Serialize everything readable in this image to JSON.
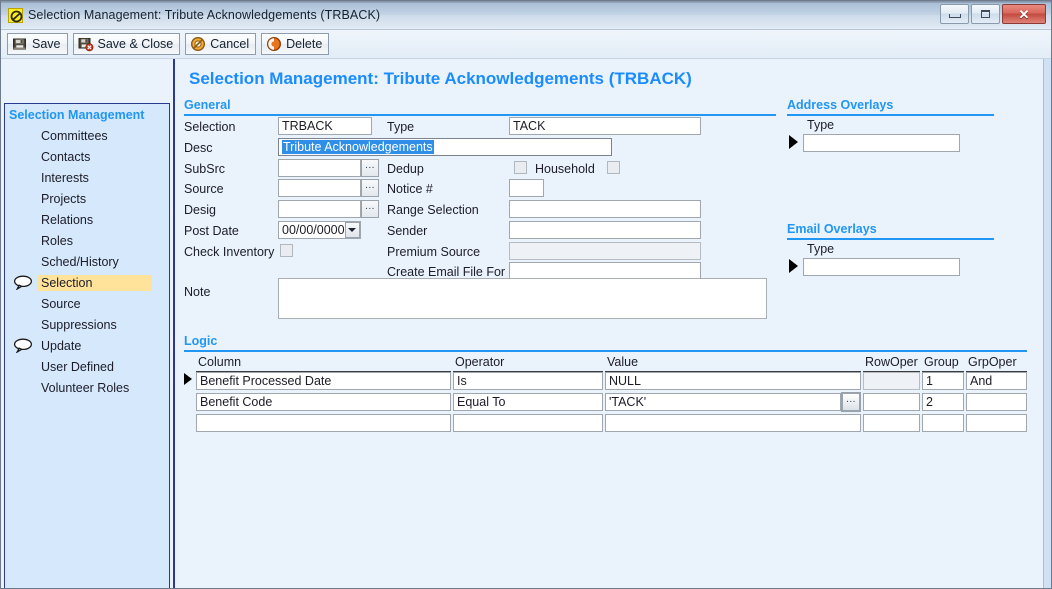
{
  "window": {
    "title": "Selection Management: Tribute Acknowledgements (TRBACK)",
    "app_icon": "prohibited-circle-icon",
    "minimize_label": "–",
    "maximize_label": "□",
    "close_label": "✕"
  },
  "toolbar": {
    "buttons": [
      {
        "label": "Save",
        "icon": "save-disk-icon"
      },
      {
        "label": "Save & Close",
        "icon": "save-close-icon"
      },
      {
        "label": "Cancel",
        "icon": "cancel-circle-icon"
      },
      {
        "label": "Delete",
        "icon": "delete-circle-icon"
      }
    ]
  },
  "sidebar": {
    "header": "Selection Management",
    "items": [
      {
        "label": "Committees",
        "bubble": false,
        "selected": false
      },
      {
        "label": "Contacts",
        "bubble": false,
        "selected": false
      },
      {
        "label": "Interests",
        "bubble": false,
        "selected": false
      },
      {
        "label": "Projects",
        "bubble": false,
        "selected": false
      },
      {
        "label": "Relations",
        "bubble": false,
        "selected": false
      },
      {
        "label": "Roles",
        "bubble": false,
        "selected": false
      },
      {
        "label": "Sched/History",
        "bubble": false,
        "selected": false
      },
      {
        "label": "Selection",
        "bubble": true,
        "selected": true
      },
      {
        "label": "Source",
        "bubble": false,
        "selected": false
      },
      {
        "label": "Suppressions",
        "bubble": false,
        "selected": false
      },
      {
        "label": "Update",
        "bubble": true,
        "selected": false
      },
      {
        "label": "User Defined",
        "bubble": false,
        "selected": false
      },
      {
        "label": "Volunteer Roles",
        "bubble": false,
        "selected": false
      }
    ]
  },
  "page": {
    "title": "Selection Management: Tribute Acknowledgements (TRBACK)"
  },
  "general": {
    "section_title": "General",
    "labels": {
      "selection": "Selection",
      "type": "Type",
      "desc": "Desc",
      "subsrc": "SubSrc",
      "dedup": "Dedup",
      "household": "Household",
      "source": "Source",
      "notice_num": "Notice #",
      "desig": "Desig",
      "range_selection": "Range Selection",
      "post_date": "Post Date",
      "sender": "Sender",
      "check_inventory": "Check Inventory",
      "premium_source": "Premium Source",
      "create_email_file_for": "Create Email File For",
      "note": "Note"
    },
    "values": {
      "selection": "TRBACK",
      "type": "TACK",
      "desc": "Tribute Acknowledgements",
      "subsrc": "",
      "source": "",
      "desig": "",
      "notice_num": "",
      "range_selection": "",
      "post_date": "00/00/0000",
      "sender": "",
      "premium_source": "",
      "create_email_file_for": "",
      "note": ""
    },
    "ellipsis_label": "...",
    "dropdown_icon": "chevron-down-icon"
  },
  "address_overlays": {
    "section_title": "Address Overlays",
    "column_header": "Type",
    "rows": [
      {
        "type": ""
      }
    ]
  },
  "email_overlays": {
    "section_title": "Email Overlays",
    "column_header": "Type",
    "rows": [
      {
        "type": ""
      }
    ]
  },
  "logic": {
    "section_title": "Logic",
    "columns": [
      "Column",
      "Operator",
      "Value",
      "RowOper",
      "Group",
      "GrpOper"
    ],
    "rows": [
      {
        "column": "Benefit Processed Date",
        "operator": "Is",
        "value": "NULL",
        "has_lookup": false,
        "rowoper": "",
        "rowoper_disabled": true,
        "group": "1",
        "grpoper": "And",
        "current": true
      },
      {
        "column": "Benefit Code",
        "operator": "Equal To",
        "value": "'TACK'",
        "has_lookup": true,
        "rowoper": "",
        "rowoper_disabled": false,
        "group": "2",
        "grpoper": "",
        "current": false
      },
      {
        "column": "",
        "operator": "",
        "value": "",
        "has_lookup": false,
        "rowoper": "",
        "rowoper_disabled": false,
        "group": "",
        "grpoper": "",
        "current": false
      }
    ],
    "lookup_label": "..."
  },
  "colors": {
    "accent_blue": "#2196f3",
    "title_blue": "#1a8cff",
    "sidebar_bg": "#d6e8fb",
    "sidebar_border": "#2b3990",
    "selected_row": "#ffe39b",
    "page_bg": "#eaf3fc",
    "text_select": "#2f8fe8"
  }
}
